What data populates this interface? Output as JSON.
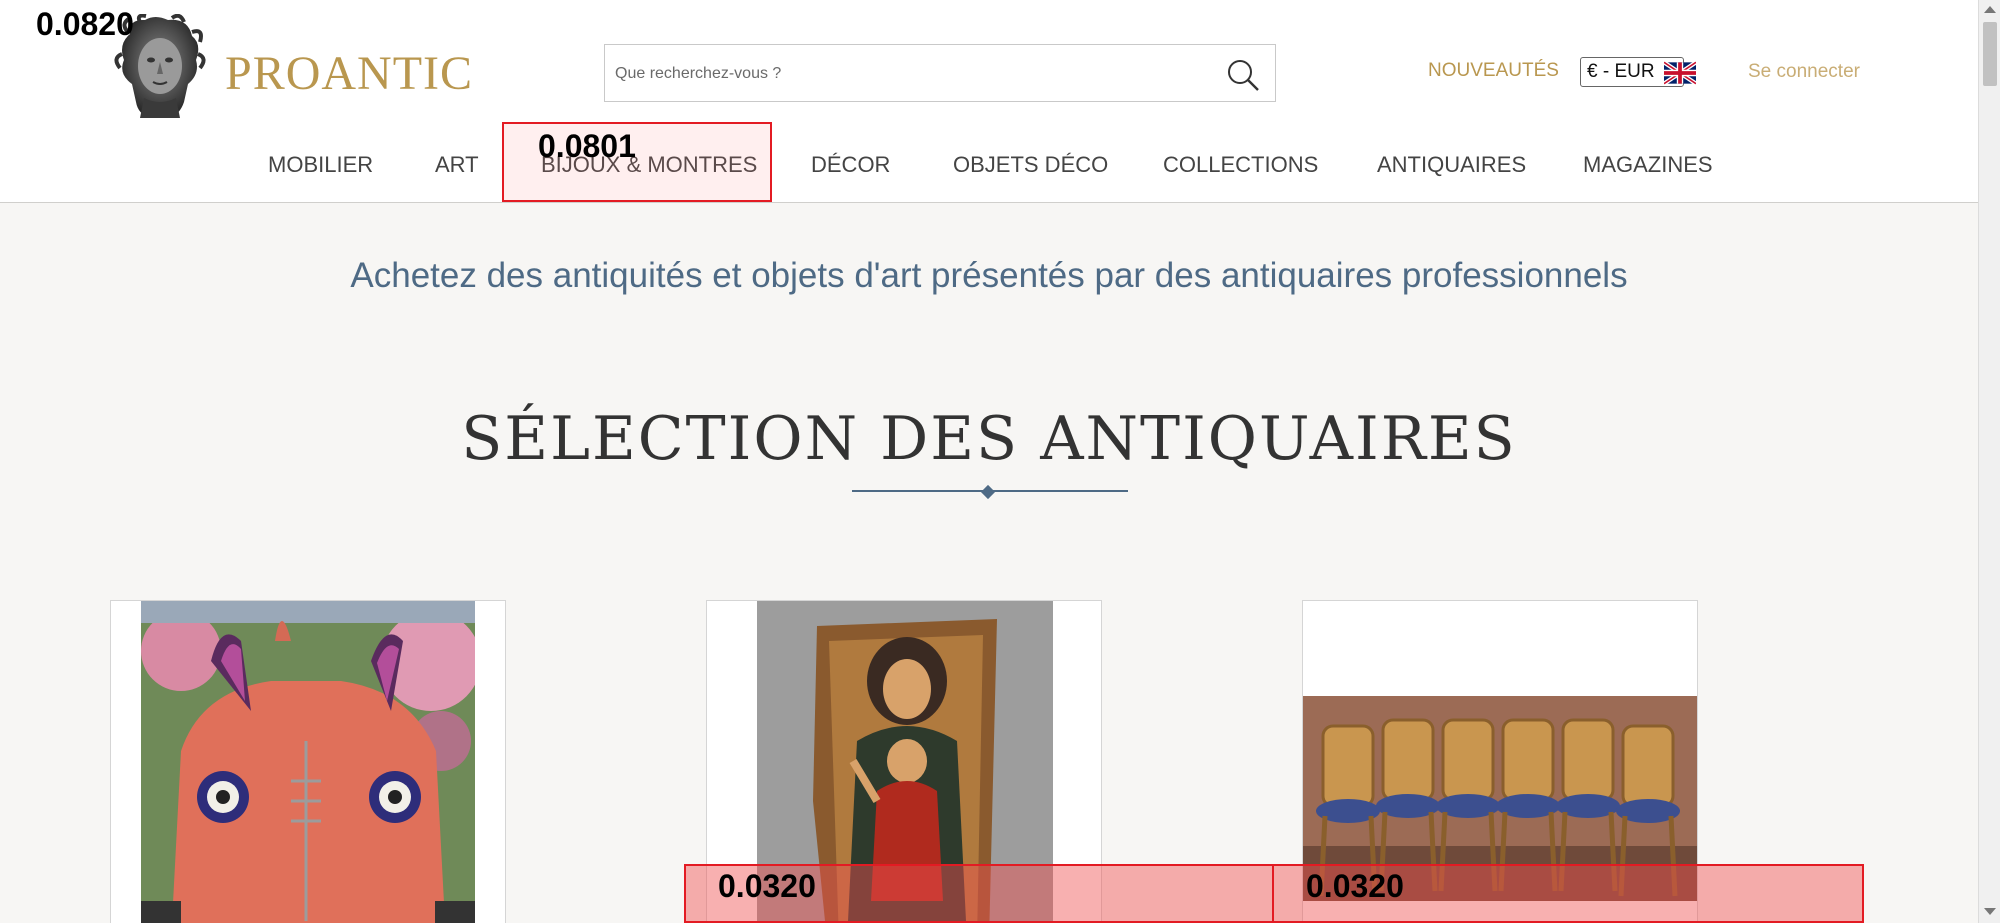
{
  "brand": {
    "name": "PROANTIC"
  },
  "search": {
    "placeholder": "Que recherchez-vous ?"
  },
  "header_links": {
    "new": "NOUVEAUTÉS",
    "currency": "€ - EUR",
    "login": "Se connecter"
  },
  "nav": {
    "items": [
      {
        "label": "MOBILIER"
      },
      {
        "label": "ART"
      },
      {
        "label": "BIJOUX & MONTRES"
      },
      {
        "label": "DÉCOR"
      },
      {
        "label": "OBJETS DÉCO"
      },
      {
        "label": "COLLECTIONS"
      },
      {
        "label": "ANTIQUAIRES"
      },
      {
        "label": "MAGAZINES"
      }
    ]
  },
  "main": {
    "tagline": "Achetez des antiquités et objets d'art présentés par des antiquaires professionnels",
    "section_title": "SÉLECTION DES ANTIQUAIRES"
  },
  "overlays": {
    "scores": [
      "0.0820",
      "0.0801",
      "0.0320",
      "0.0320"
    ]
  },
  "colors": {
    "brand_gold": "#b9974f",
    "tagline_blue": "#4e6a85",
    "highlight_red": "#e31b23"
  }
}
